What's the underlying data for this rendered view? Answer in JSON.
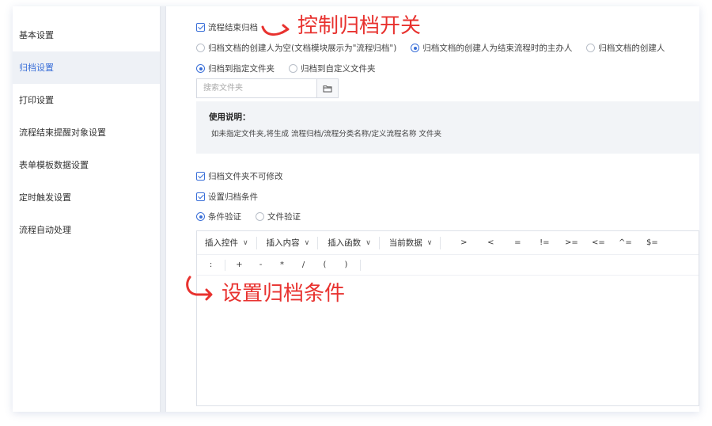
{
  "sidebar": {
    "items": [
      {
        "label": "基本设置",
        "active": false
      },
      {
        "label": "归档设置",
        "active": true
      },
      {
        "label": "打印设置",
        "active": false
      },
      {
        "label": "流程结束提醒对象设置",
        "active": false
      },
      {
        "label": "表单模板数据设置",
        "active": false
      },
      {
        "label": "定时触发设置",
        "active": false
      },
      {
        "label": "流程自动处理",
        "active": false
      }
    ]
  },
  "archive": {
    "end_archive_label": "流程结束归档",
    "end_archive_checked": true,
    "creator_options": [
      {
        "label": "归档文档的创建人为空(文档模块展示为\"流程归档\")",
        "selected": false
      },
      {
        "label": "归档文档的创建人为结束流程时的主办人",
        "selected": true
      },
      {
        "label": "归档文档的创建人",
        "selected": false
      }
    ],
    "folder_options": [
      {
        "label": "归档到指定文件夹",
        "selected": true
      },
      {
        "label": "归档到自定义文件夹",
        "selected": false
      }
    ],
    "search_placeholder": "搜索文件夹",
    "usage_title": "使用说明：",
    "usage_desc": "如未指定文件夹,将生成 流程归档/流程分类名称/定义流程名称 文件夹",
    "folder_locked_label": "归档文件夹不可修改",
    "folder_locked_checked": true,
    "condition_label": "设置归档条件",
    "condition_checked": true,
    "verify_options": [
      {
        "label": "条件验证",
        "selected": true
      },
      {
        "label": "文件验证",
        "selected": false
      }
    ]
  },
  "editor": {
    "dropdowns": [
      "插入控件",
      "插入内容",
      "插入函数",
      "当前数据"
    ],
    "operators_row1": [
      ">",
      "<",
      "=",
      "!=",
      ">=",
      "<=",
      "^=",
      "$="
    ],
    "operators_row2": [
      ":",
      "+",
      "-",
      "*",
      "/",
      "(",
      ")"
    ]
  },
  "annotations": {
    "top": "控制归档开关",
    "bottom": "设置归档条件",
    "color": "#e8322f"
  }
}
